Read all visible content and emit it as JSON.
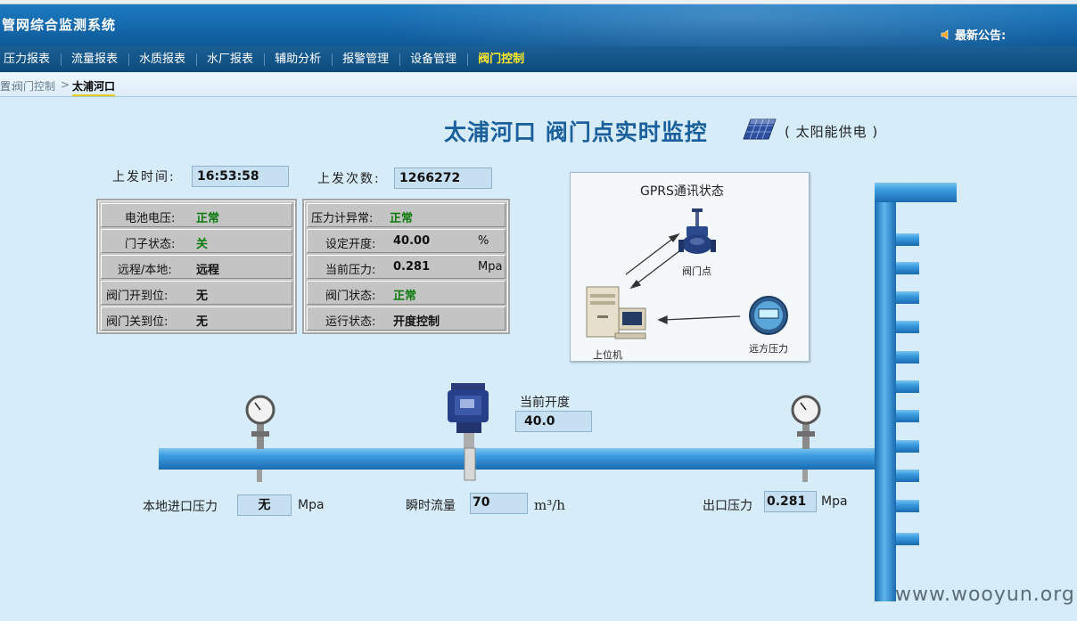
{
  "header": {
    "system_title": "管网综合监测系统",
    "notice_label": "最新公告:"
  },
  "nav": {
    "items": [
      {
        "label": "压力报表"
      },
      {
        "label": "流量报表"
      },
      {
        "label": "水质报表"
      },
      {
        "label": "水厂报表"
      },
      {
        "label": "辅助分析"
      },
      {
        "label": "报警管理"
      },
      {
        "label": "设备管理"
      },
      {
        "label": "阀门控制",
        "active": true
      }
    ]
  },
  "breadcrumb": {
    "prefix": "置:",
    "parent": "阀门控制",
    "separator": ">",
    "current": "太浦河口"
  },
  "page": {
    "title": "太浦河口 阀门点实时监控",
    "power_note": "( 太阳能供电 )"
  },
  "upload": {
    "time_label": "上发时间:",
    "time_value": "16:53:58",
    "count_label": "上发次数:",
    "count_value": "1266272"
  },
  "left_panel": [
    {
      "label": "电池电压:",
      "value": "正常",
      "green": true
    },
    {
      "label": "门子状态:",
      "value": "关",
      "green": true
    },
    {
      "label": "远程/本地:",
      "value": "远程",
      "green": false
    },
    {
      "label": "阀门开到位:",
      "value": "无",
      "green": false
    },
    {
      "label": "阀门关到位:",
      "value": "无",
      "green": false
    }
  ],
  "right_panel": [
    {
      "label": "压力计异常:",
      "value": "正常",
      "unit": "",
      "green": true
    },
    {
      "label": "设定开度:",
      "value": "40.00",
      "unit": "%",
      "green": false
    },
    {
      "label": "当前压力:",
      "value": "0.281",
      "unit": "Mpa",
      "green": false
    },
    {
      "label": "阀门状态:",
      "value": "正常",
      "unit": "",
      "green": true
    },
    {
      "label": "运行状态:",
      "value": "开度控制",
      "unit": "",
      "green": false
    }
  ],
  "gprs": {
    "title": "GPRS通讯状态",
    "valve_point": "阀门点",
    "host_pc": "上位机",
    "remote_pressure": "远方压力"
  },
  "valve": {
    "opening_label": "当前开度",
    "opening_value": "40.0"
  },
  "measurements": {
    "inlet_label": "本地进口压力",
    "inlet_value": "无",
    "inlet_unit": "Mpa",
    "flow_label": "瞬时流量",
    "flow_value": "70",
    "flow_unit": "m³/h",
    "outlet_label": "出口压力",
    "outlet_value": "0.281",
    "outlet_unit": "Mpa"
  },
  "watermark": "www.wooyun.org",
  "colors": {
    "header_blue": "#1569ad",
    "nav_active": "#ffea2a",
    "status_green": "#0c7a0c",
    "pipe_blue": "#2a8ad0",
    "title_blue": "#1b5f9c"
  }
}
